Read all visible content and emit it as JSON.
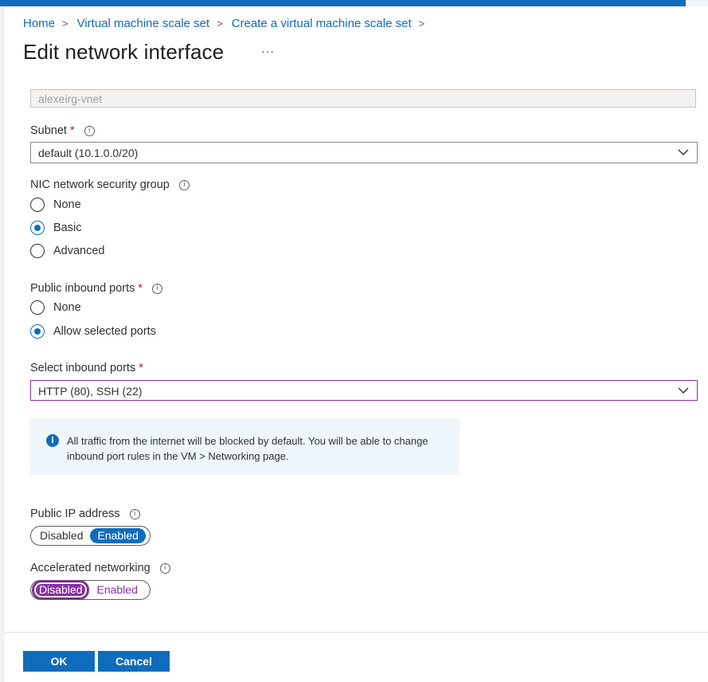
{
  "breadcrumb": {
    "items": [
      "Home",
      "Virtual machine scale set",
      "Create a virtual machine scale set"
    ]
  },
  "page": {
    "title": "Edit network interface",
    "more_label": "···"
  },
  "virtual_network": {
    "value": "alexeirg-vnet"
  },
  "subnet": {
    "label": "Subnet",
    "required_mark": "*",
    "value": "default (10.1.0.0/20)"
  },
  "nic_nsg": {
    "label": "NIC network security group",
    "options": [
      "None",
      "Basic",
      "Advanced"
    ],
    "selected": "Basic"
  },
  "public_inbound_ports": {
    "label": "Public inbound ports",
    "required_mark": "*",
    "options": [
      "None",
      "Allow selected ports"
    ],
    "selected": "Allow selected ports"
  },
  "select_inbound_ports": {
    "label": "Select inbound ports",
    "required_mark": "*",
    "value": "HTTP (80), SSH (22)"
  },
  "info_message": {
    "text": "All traffic from the internet will be blocked by default. You will be able to change inbound port rules in the VM > Networking page."
  },
  "public_ip": {
    "label": "Public IP address",
    "off_label": "Disabled",
    "on_label": "Enabled",
    "selected": "Enabled"
  },
  "accelerated_networking": {
    "label": "Accelerated networking",
    "off_label": "Disabled",
    "on_label": "Enabled",
    "selected": "Disabled"
  },
  "footer": {
    "ok_label": "OK",
    "cancel_label": "Cancel"
  },
  "colors": {
    "accent": "#0f6cbd",
    "focus": "#8b2fa8",
    "required": "#a4262c",
    "info_bg": "#eff6fc"
  },
  "icons": [
    "chevron-right-icon",
    "info-icon",
    "chevron-down-icon",
    "info-circle-filled-icon"
  ]
}
